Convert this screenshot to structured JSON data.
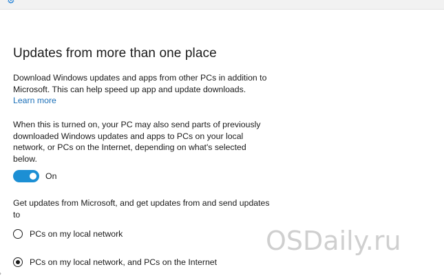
{
  "header": {
    "icon": "gear-icon"
  },
  "page": {
    "title": "Updates from more than one place",
    "description_line": "Download Windows updates and apps from other PCs in addition to Microsoft. This can help speed up app and update downloads.",
    "learn_more": "Learn more",
    "explanation": "When this is turned on, your PC may also send parts of previously downloaded Windows updates and apps to PCs on your local network, or PCs on the Internet, depending on what's selected below.",
    "toggle": {
      "state_label": "On",
      "checked": true
    },
    "options_intro": "Get updates from Microsoft, and get updates from and send updates to",
    "options": [
      {
        "label": "PCs on my local network",
        "selected": false
      },
      {
        "label": "PCs on my local network, and PCs on the Internet",
        "selected": true
      }
    ]
  },
  "watermark": "OSDaily.ru",
  "colors": {
    "accent": "#1c8fd4",
    "link": "#1a6fb8"
  }
}
